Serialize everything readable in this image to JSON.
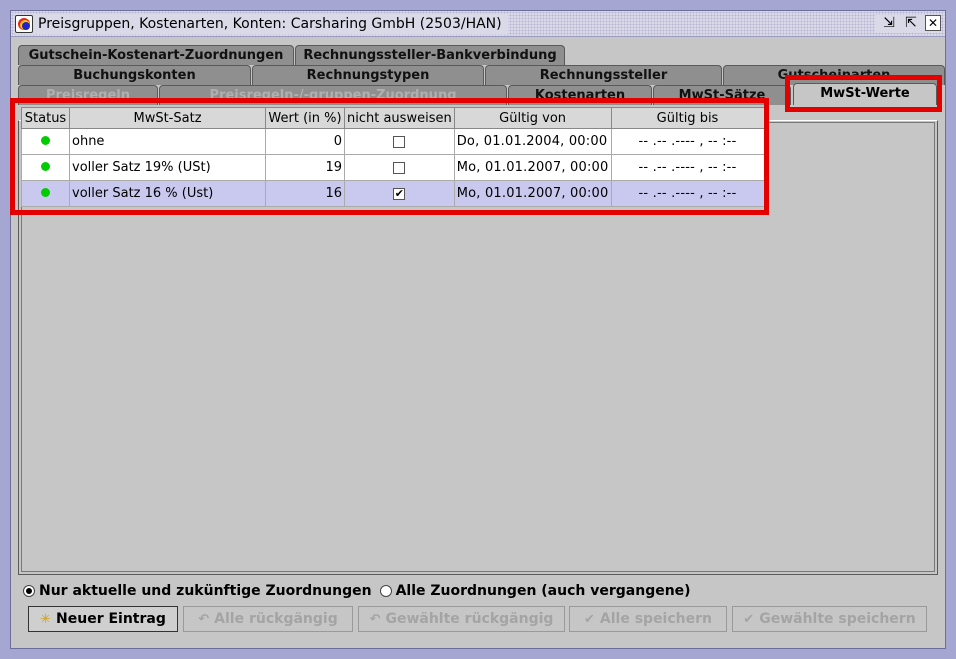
{
  "window": {
    "title": "Preisgruppen, Kostenarten, Konten: Carsharing GmbH (2503/HAN)",
    "buttons": {
      "minimize": "⇲",
      "maximize": "⇱",
      "close": "✕"
    }
  },
  "tabs": {
    "row1": [
      "Gutschein-Kostenart-Zuordnungen",
      "Rechnungssteller-Bankverbindung"
    ],
    "row2": [
      "Buchungskonten",
      "Rechnungstypen",
      "Rechnungssteller",
      "Gutscheinarten"
    ],
    "row3": [
      "Preisregeln",
      "Preisregeln-/-gruppen-Zuordnung",
      "Kostenarten",
      "MwSt-Sätze",
      "MwSt-Werte"
    ],
    "active": "MwSt-Werte"
  },
  "table": {
    "columns": [
      "Status",
      "MwSt-Satz",
      "Wert (in %)",
      "nicht ausweisen",
      "Gültig von",
      "Gültig bis"
    ],
    "rows": [
      {
        "status": "aktiv",
        "name": "ohne",
        "value": "0",
        "hide": false,
        "from": "Do, 01.01.2004, 00:00",
        "to": "-- .-- .----  , -- :--"
      },
      {
        "status": "aktiv",
        "name": "voller Satz 19% (USt)",
        "value": "19",
        "hide": false,
        "from": "Mo, 01.01.2007, 00:00",
        "to": "-- .-- .----  , -- :--"
      },
      {
        "status": "aktiv",
        "name": "voller Satz 16 % (Ust)",
        "value": "16",
        "hide": true,
        "from": "Mo, 01.01.2007, 00:00",
        "to": "-- .-- .----  , -- :--"
      }
    ],
    "selected_row": 2
  },
  "filter": {
    "option1": "Nur aktuelle und zukünftige Zuordnungen",
    "option2": "Alle Zuordnungen (auch vergangene)",
    "selected": "option1"
  },
  "actions": {
    "new_entry": "Neuer Eintrag",
    "undo_all": "Alle rückgängig",
    "undo_selected": "Gewählte rückgängig",
    "save_all": "Alle speichern",
    "save_selected": "Gewählte speichern"
  },
  "colors": {
    "status_active": "#00cc00",
    "highlight": "#e50000",
    "selection": "#c9c9f0"
  }
}
